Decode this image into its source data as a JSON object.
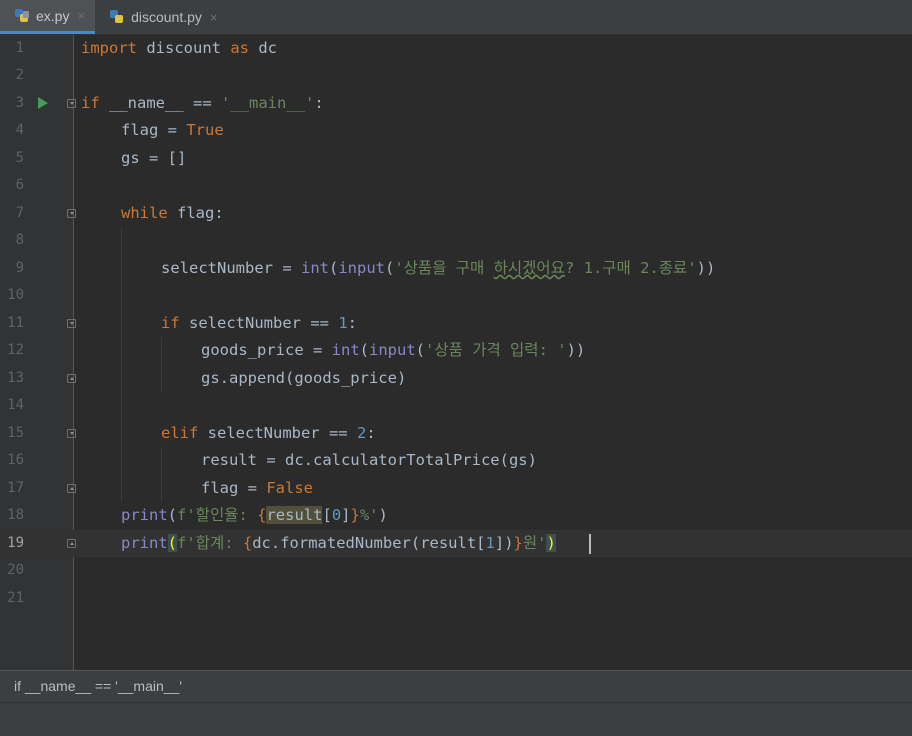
{
  "tabs": [
    {
      "label": "ex.py",
      "active": true
    },
    {
      "label": "discount.py",
      "active": false
    }
  ],
  "close_glyph": "×",
  "line_numbers": [
    "1",
    "2",
    "3",
    "4",
    "5",
    "6",
    "7",
    "8",
    "9",
    "10",
    "11",
    "12",
    "13",
    "14",
    "15",
    "16",
    "17",
    "18",
    "19",
    "20",
    "21"
  ],
  "current_line": "19",
  "breadcrumb": "if __name__ == '__main__'",
  "colors": {
    "keyword": "#cc7832",
    "string": "#6a8759",
    "number": "#6897bb",
    "builtin": "#8888c6",
    "text": "#a9b7c6",
    "background": "#2b2b2b",
    "run_icon": "#499c54"
  },
  "code": {
    "l1": {
      "kw1": "import",
      "t1": " discount ",
      "kw2": "as",
      "t2": " dc"
    },
    "l3": {
      "kw1": "if",
      "t1": " __name__ == ",
      "s1": "'__main__'",
      "t2": ":"
    },
    "l4": {
      "t1": "flag = ",
      "kw1": "True"
    },
    "l5": {
      "t1": "gs = []"
    },
    "l7": {
      "kw1": "while",
      "t1": " flag:"
    },
    "l9": {
      "t1": "selectNumber = ",
      "b1": "int",
      "t2": "(",
      "b2": "input",
      "t3": "(",
      "s1": "'상품을 구매 ",
      "s2": "하시겠어요",
      "s3": "? 1.구매 2.종료'",
      "t4": "))"
    },
    "l11": {
      "kw1": "if",
      "t1": " selectNumber == ",
      "n1": "1",
      "t2": ":"
    },
    "l12": {
      "t1": "goods_price = ",
      "b1": "int",
      "t2": "(",
      "b2": "input",
      "t3": "(",
      "s1": "'상품 가격 입력: '",
      "t4": "))"
    },
    "l13": {
      "t1": "gs.append(goods_price)"
    },
    "l15": {
      "kw1": "elif",
      "t1": " selectNumber == ",
      "n1": "2",
      "t2": ":"
    },
    "l16": {
      "t1": "result = dc.calculatorTotalPrice(gs)"
    },
    "l17": {
      "t1": "flag = ",
      "kw1": "False"
    },
    "l18": {
      "b1": "print",
      "t1": "(",
      "s1": "f'할인율: ",
      "kw1": "{",
      "t2": "result",
      "t3": "[",
      "n1": "0",
      "t4": "]",
      "kw2": "}",
      "s2": "%'",
      "t5": ")"
    },
    "l19": {
      "b1": "print",
      "p1": "(",
      "s1": "f'합계: ",
      "kw1": "{",
      "t1": "dc.formatedNumber(result[",
      "n1": "1",
      "t2": "])",
      "kw2": "}",
      "s2": "원'",
      "p2": ")"
    }
  }
}
